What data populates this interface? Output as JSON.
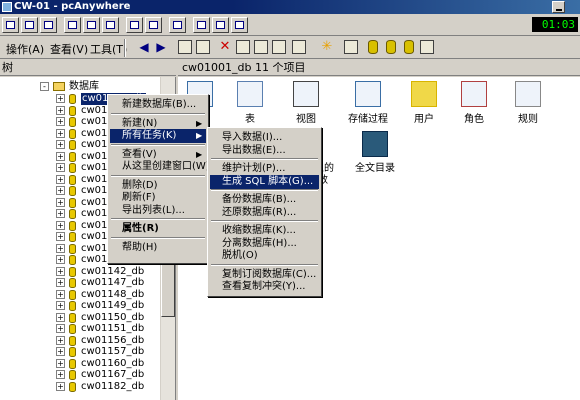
{
  "window": {
    "title": "CW-01 - pcAnywhere",
    "clock": "01:03"
  },
  "menubar": {
    "action": "操作(A)",
    "view": "查看(V)",
    "tools": "工具(T)"
  },
  "tree": {
    "header": "树",
    "root": "数据库",
    "selected": "cw01001_db",
    "items": [
      "cw01",
      "cw01",
      "cw01",
      "cw01",
      "cw01",
      "cw01",
      "cw01",
      "cw01",
      "cw01",
      "cw01",
      "cw01",
      "cw01",
      "cw01"
    ],
    "items_full": [
      "cw01133_db",
      "cw01142_db",
      "cw01147_db",
      "cw01148_db",
      "cw01149_db",
      "cw01150_db",
      "cw01151_db",
      "cw01156_db",
      "cw01157_db",
      "cw01160_db",
      "cw01167_db"
    ],
    "cut_last": "cw01182_db"
  },
  "right": {
    "header": "cw01001_db    11 个项目",
    "icons": [
      {
        "label": "图",
        "icon": "diagram-icon"
      },
      {
        "label": "表",
        "icon": "table-icon"
      },
      {
        "label": "视图",
        "icon": "view-icon"
      },
      {
        "label": "存储过程",
        "icon": "stored-procedure-icon"
      },
      {
        "label": "用户",
        "icon": "user-icon"
      },
      {
        "label": "角色",
        "icon": "role-icon"
      },
      {
        "label": "规则",
        "icon": "rule-icon"
      }
    ],
    "row2": [
      {
        "label": "义的",
        "sub": "数",
        "icon": "udf-icon"
      },
      {
        "label": "全文目录",
        "icon": "fulltext-catalog-icon"
      }
    ]
  },
  "context_menu": {
    "items": [
      {
        "label": "新建数据库(B)...",
        "type": "item"
      },
      {
        "type": "sep"
      },
      {
        "label": "新建(N)",
        "type": "submenu"
      },
      {
        "label": "所有任务(K)",
        "type": "submenu",
        "highlight": true
      },
      {
        "type": "sep"
      },
      {
        "label": "查看(V)",
        "type": "submenu"
      },
      {
        "label": "从这里创建窗口(W)",
        "type": "item"
      },
      {
        "type": "sep"
      },
      {
        "label": "删除(D)",
        "type": "item"
      },
      {
        "label": "刷新(F)",
        "type": "item"
      },
      {
        "label": "导出列表(L)...",
        "type": "item"
      },
      {
        "type": "sep"
      },
      {
        "label": "属性(R)",
        "type": "item",
        "bold": true
      },
      {
        "type": "sep"
      },
      {
        "label": "帮助(H)",
        "type": "item"
      }
    ]
  },
  "submenu": {
    "items": [
      {
        "label": "导入数据(I)...",
        "type": "item"
      },
      {
        "label": "导出数据(E)...",
        "type": "item"
      },
      {
        "type": "sep"
      },
      {
        "label": "维护计划(P)...",
        "type": "item"
      },
      {
        "label": "生成 SQL 脚本(G)...",
        "type": "item",
        "highlight": true
      },
      {
        "type": "sep"
      },
      {
        "label": "备份数据库(B)...",
        "type": "item"
      },
      {
        "label": "还原数据库(R)...",
        "type": "item"
      },
      {
        "type": "sep"
      },
      {
        "label": "收缩数据库(K)...",
        "type": "item"
      },
      {
        "label": "分离数据库(H)...",
        "type": "item"
      },
      {
        "label": "脱机(O)",
        "type": "item"
      },
      {
        "type": "sep"
      },
      {
        "label": "复制订阅数据库(C)...",
        "type": "item"
      },
      {
        "label": "查看复制冲突(Y)...",
        "type": "item"
      }
    ]
  },
  "colors": {
    "selection": "#0a246a",
    "face": "#d4d0c8",
    "title": "#0a246a"
  }
}
